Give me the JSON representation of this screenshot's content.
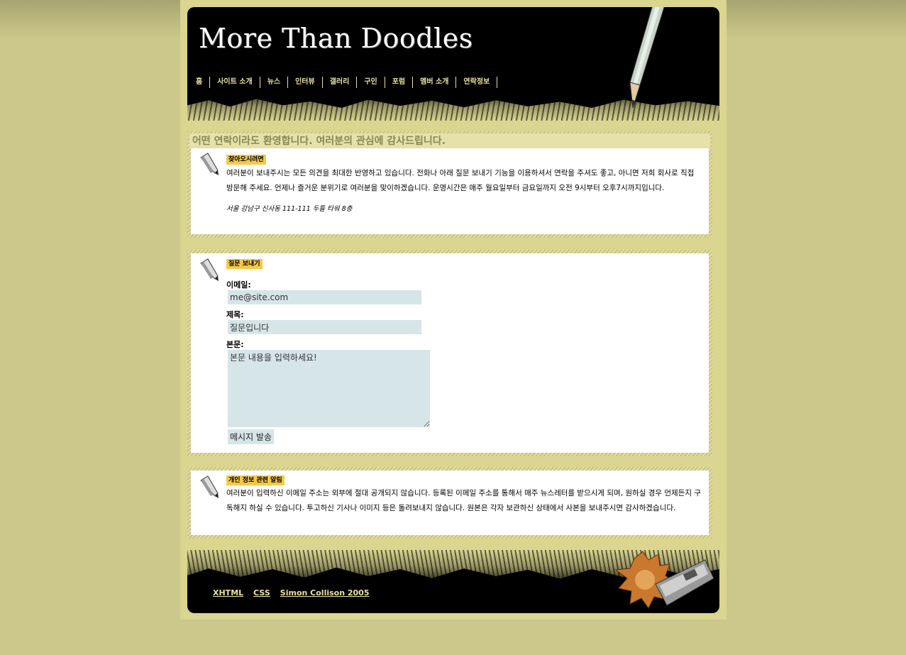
{
  "site": {
    "title": "More Than Doodles"
  },
  "nav": [
    "홈",
    "사이트 소개",
    "뉴스",
    "인터뷰",
    "갤러리",
    "구인",
    "포럼",
    "멤버 소개",
    "연락정보"
  ],
  "contact": {
    "heading": "어떤 연락이라도 환영합니다. 여러분의 관심에 감사드립니다.",
    "label": "찾아오시려면",
    "text": "여러분이 보내주시는 모든 의견을 최대한 반영하고 있습니다. 전화나 아래 질문 보내기 기능을 이용하셔서 연락을 주셔도 좋고, 아니면 저희 회사로 직접 방문해 주세요. 언제나 즐거운 분위기로 여러분을 맞이하겠습니다. 운영시간은 매주 월요일부터 금요일까지 오전 9시부터 오후7시까지입니다.",
    "address": "서울 강남구 신사동 111-111 두들 타워 8층"
  },
  "form": {
    "label": "질문 보내기",
    "email_label": "이메일:",
    "email_value": "me@site.com",
    "subject_label": "제목:",
    "subject_value": "질문입니다",
    "body_label": "본문:",
    "body_value": "본문 내용을 입력하세요!",
    "submit": "메시지 발송"
  },
  "privacy": {
    "label": "개인 정보 관련 알림",
    "text": "여러분이 입력하신 이메일 주소는 외부에 절대 공개되지 않습니다. 등록된 이메일 주소를 통해서 매주 뉴스레터를 받으시게 되며, 원하실 경우 언제든지 구독해지 하실 수 있습니다. 투고하신 기사나 이미지 등은 돌려보내지 않습니다. 원본은 각자 보관하신 상태에서 사본을 보내주시면 감사하겠습니다."
  },
  "footer": {
    "links": [
      "XHTML",
      "CSS",
      "Simon Collison 2005"
    ]
  }
}
